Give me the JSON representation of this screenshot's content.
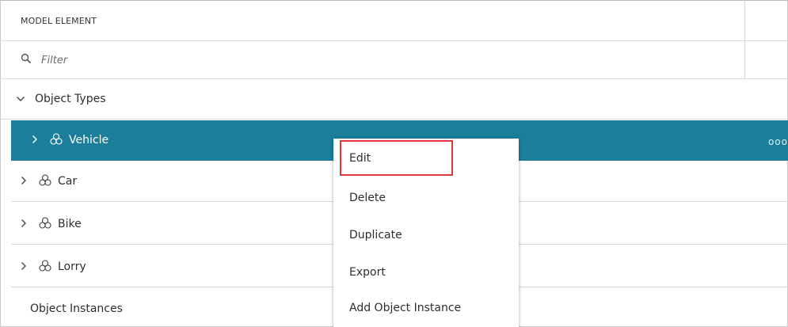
{
  "header": {
    "title": "MODEL ELEMENT"
  },
  "filter": {
    "placeholder": "Filter"
  },
  "tree": {
    "group_label": "Object Types",
    "items": [
      {
        "label": "Vehicle",
        "selected": true,
        "icon": "cube-icon"
      },
      {
        "label": "Car",
        "selected": false,
        "icon": "cube-icon"
      },
      {
        "label": "Bike",
        "selected": false,
        "icon": "cube-icon"
      },
      {
        "label": "Lorry",
        "selected": false,
        "icon": "cube-icon"
      }
    ],
    "instances_label": "Object Instances",
    "more_label": "ooo"
  },
  "context_menu": {
    "items": [
      "Edit",
      "Delete",
      "Duplicate",
      "Export",
      "Add Object Instance"
    ],
    "highlighted": "Edit"
  },
  "colors": {
    "selected_row": "#1b7f9c",
    "highlight_border": "#e0383b"
  }
}
